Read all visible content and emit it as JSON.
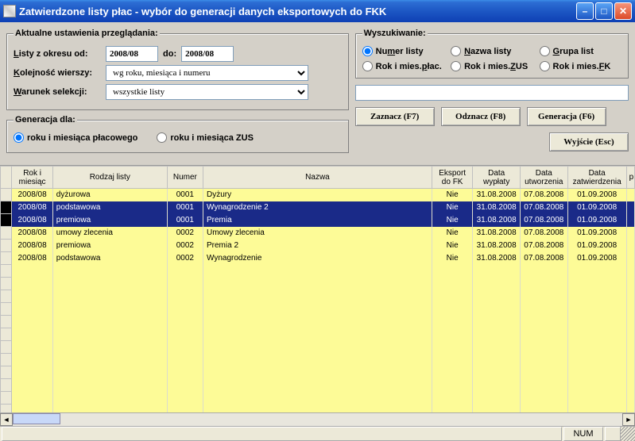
{
  "title": "Zatwierdzone listy płac - wybór do generacji danych eksportowych do FKK",
  "settings": {
    "legend": "Aktualne ustawienia przeglądania:",
    "periodFromLabel": "Listy z okresu od:",
    "periodToLabel": "do:",
    "periodFrom": "2008/08",
    "periodTo": "2008/08",
    "orderLabel": "Kolejność wierszy:",
    "orderValue": "wg roku, miesiąca i numeru",
    "selectionLabel": "Warunek selekcji:",
    "selectionValue": "wszystkie listy"
  },
  "generation": {
    "legend": "Generacja dla:",
    "opt1": "roku i miesiąca płacowego",
    "opt2": "roku i miesiąca ZUS"
  },
  "search": {
    "legend": "Wyszukiwanie:",
    "opts": {
      "numer": "Numer listy",
      "nazwa": "Nazwa listy",
      "grupa": "Grupa list",
      "rokPlac": "Rok i mies.płac.",
      "rokZus": "Rok i mies.ZUS",
      "rokFk": "Rok i mies.FK"
    },
    "value": ""
  },
  "buttons": {
    "zaznacz": "Zaznacz (F7)",
    "odznacz": "Odznacz (F8)",
    "generacja": "Generacja (F6)",
    "wyjscie": "Wyjście (Esc)"
  },
  "grid": {
    "headers": {
      "rokMiesiac": "Rok i miesiąc",
      "rodzaj": "Rodzaj listy",
      "numer": "Numer",
      "nazwa": "Nazwa",
      "eksport": "Eksport do FK",
      "dataWyplaty": "Data wypłaty",
      "dataUtworzenia": "Data utworzenia",
      "dataZatw": "Data zatwierdzenia",
      "p": "p"
    },
    "rows": [
      {
        "ym": "2008/08",
        "rodzaj": "dyżurowa",
        "numer": "0001",
        "nazwa": "Dyżury",
        "eksport": "Nie",
        "wypl": "31.08.2008",
        "utw": "07.08.2008",
        "zatw": "01.09.2008",
        "sel": false
      },
      {
        "ym": "2008/08",
        "rodzaj": "podstawowa",
        "numer": "0001",
        "nazwa": "Wynagrodzenie 2",
        "eksport": "Nie",
        "wypl": "31.08.2008",
        "utw": "07.08.2008",
        "zatw": "01.09.2008",
        "sel": true
      },
      {
        "ym": "2008/08",
        "rodzaj": "premiowa",
        "numer": "0001",
        "nazwa": "Premia",
        "eksport": "Nie",
        "wypl": "31.08.2008",
        "utw": "07.08.2008",
        "zatw": "01.09.2008",
        "sel": true
      },
      {
        "ym": "2008/08",
        "rodzaj": "umowy zlecenia",
        "numer": "0002",
        "nazwa": "Umowy zlecenia",
        "eksport": "Nie",
        "wypl": "31.08.2008",
        "utw": "07.08.2008",
        "zatw": "01.09.2008",
        "sel": false
      },
      {
        "ym": "2008/08",
        "rodzaj": "premiowa",
        "numer": "0002",
        "nazwa": "Premia 2",
        "eksport": "Nie",
        "wypl": "31.08.2008",
        "utw": "07.08.2008",
        "zatw": "01.09.2008",
        "sel": false
      },
      {
        "ym": "2008/08",
        "rodzaj": "podstawowa",
        "numer": "0002",
        "nazwa": "Wynagrodzenie",
        "eksport": "Nie",
        "wypl": "31.08.2008",
        "utw": "07.08.2008",
        "zatw": "01.09.2008",
        "sel": false
      }
    ]
  },
  "status": {
    "num": "NUM"
  }
}
